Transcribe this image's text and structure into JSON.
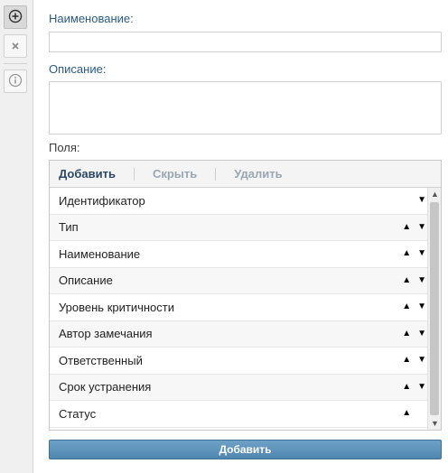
{
  "toolbar": {
    "buttons": [
      {
        "icon": "add-circle-icon",
        "glyph": "⊕"
      },
      {
        "icon": "close-icon",
        "glyph": "×"
      },
      {
        "icon": "info-icon",
        "glyph": "i"
      }
    ]
  },
  "form": {
    "name_label": "Наименование:",
    "name_value": "",
    "description_label": "Описание:",
    "description_value": "",
    "fields_label": "Поля:"
  },
  "fields_panel": {
    "toolbar": {
      "add": "Добавить",
      "hide": "Скрыть",
      "delete": "Удалить"
    },
    "rows": [
      {
        "label": "Идентификатор",
        "up": false,
        "down": true
      },
      {
        "label": "Тип",
        "up": true,
        "down": true
      },
      {
        "label": "Наименование",
        "up": true,
        "down": true
      },
      {
        "label": "Описание",
        "up": true,
        "down": true
      },
      {
        "label": "Уровень критичности",
        "up": true,
        "down": true
      },
      {
        "label": "Автор замечания",
        "up": true,
        "down": true
      },
      {
        "label": "Ответственный",
        "up": true,
        "down": true
      },
      {
        "label": "Срок устранения",
        "up": true,
        "down": true
      },
      {
        "label": "Статус",
        "up": true,
        "down": false
      }
    ]
  },
  "submit_label": "Добавить",
  "colors": {
    "label_blue": "#2b5a83",
    "submit_bg": "#5a8fb8"
  }
}
